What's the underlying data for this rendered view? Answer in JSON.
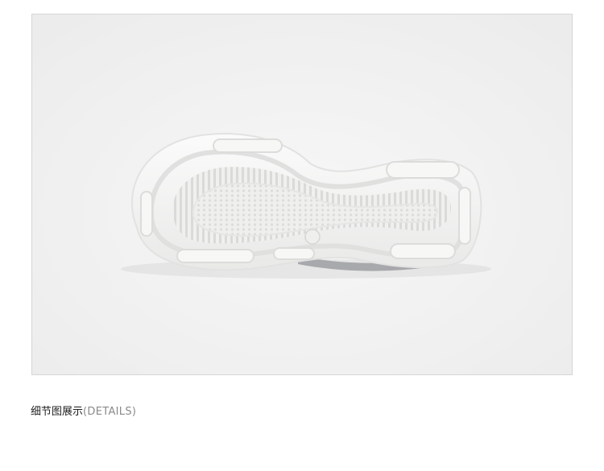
{
  "image": {
    "subject": "shoe-outsole-photo",
    "background_color": "#f2f2f2",
    "sole_color": "#f5f5f4"
  },
  "caption": {
    "main": "细节图展示",
    "sub": "(DETAILS)"
  }
}
